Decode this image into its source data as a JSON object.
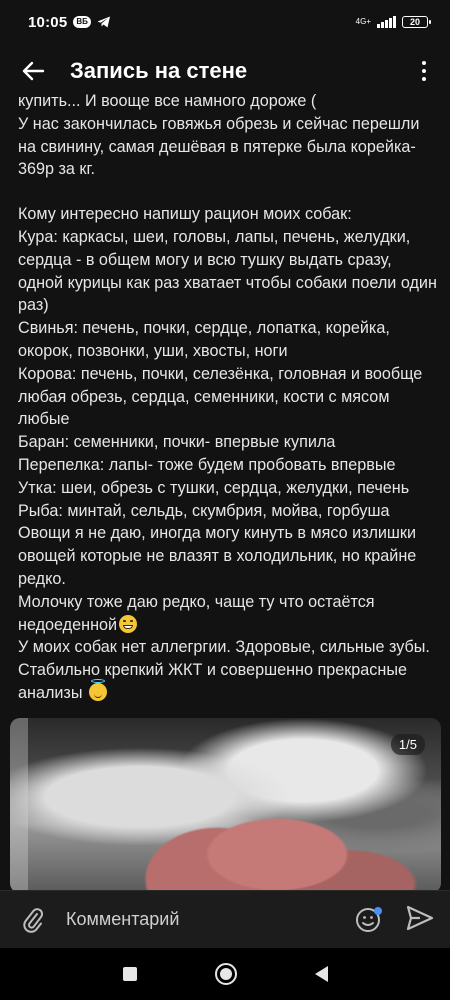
{
  "status_bar": {
    "time": "10:05",
    "vk_badge": "ВБ",
    "network": "4G+",
    "battery": "20"
  },
  "app_bar": {
    "title": "Запись на стене"
  },
  "post": {
    "paragraphs": [
      "купить... И вооще все намного дороже (\nУ нас закончилась говяжья обрезь и сейчас перешли на свинину, самая дешёвая в пятерке была корейка- 369р за кг.",
      "Кому интересно напишу рацион моих собак:\nКура: каркасы, шеи, головы, лапы, печень, желудки, сердца - в общем могу и всю тушку выдать сразу, одной курицы как раз хватает чтобы собаки поели один раз)\nСвинья: печень, почки, сердце, лопатка, корейка, окорок, позвонки, уши, хвосты, ноги\nКорова: печень, почки, селезёнка, головная и вообще любая обрезь, сердца, семенники, кости с мясом любые\nБаран: семенники, почки- впервые купила\nПерепелка: лапы- тоже будем пробовать впервые\nУтка: шеи, обрезь с тушки, сердца, желудки, печень\nРыба: минтай, сельдь, скумбрия, мойва, горбуша\n Овощи я не даю, иногда могу кинуть в мясо излишки овощей которые не влазят в холодильник, но крайне редко.\nМолочку тоже даю редко, чаще ту что остаётся недоеденной",
      "У моих собак нет аллегргии. Здоровые, сильные зубы. Стабильно крепкий ЖКТ и совершенно прекрасные анализы"
    ]
  },
  "photo": {
    "counter": "1/5"
  },
  "comment": {
    "placeholder": "Комментарий"
  }
}
